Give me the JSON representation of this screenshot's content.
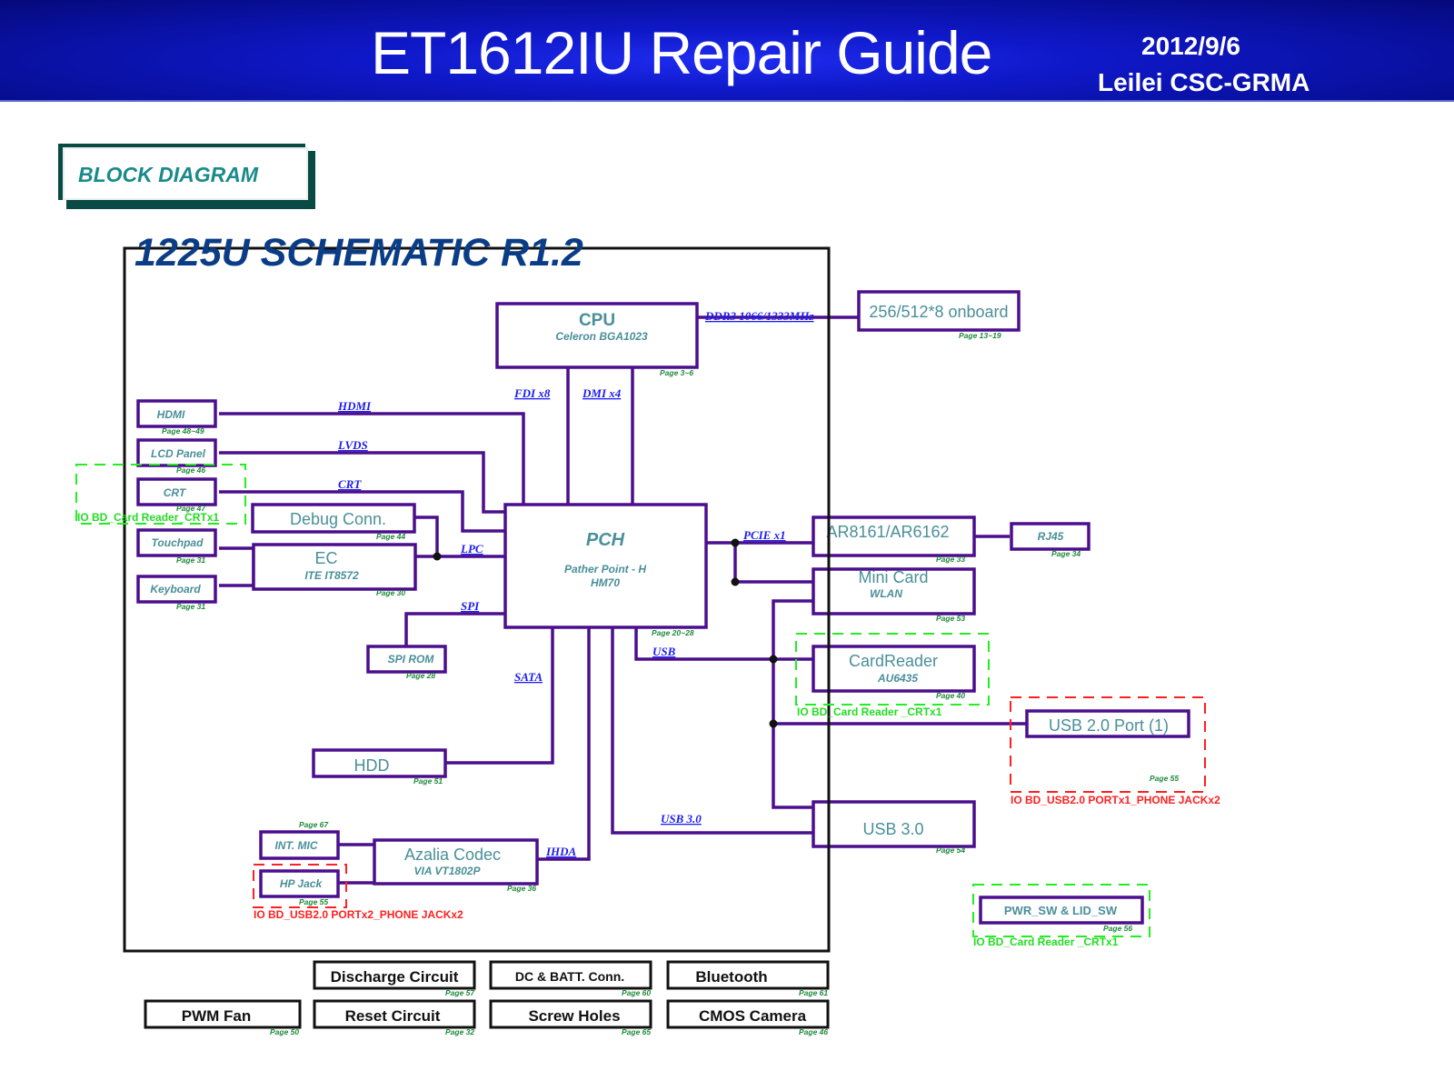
{
  "header": {
    "title": "ET1612IU Repair Guide",
    "date": "2012/9/6",
    "author": "Leilei CSC-GRMA"
  },
  "section_label": "BLOCK DIAGRAM",
  "schematic_title": "1225U SCHEMATIC R1.2",
  "blocks": {
    "cpu": {
      "title": "CPU",
      "sub": "Celeron BGA1023",
      "page": "Page 3~6"
    },
    "memory": {
      "title": "256/512*8 onboard",
      "page": "Page 13~19"
    },
    "pch": {
      "title": "PCH",
      "sub1": "Pather Point - H",
      "sub2": "HM70",
      "page": "Page 20~28"
    },
    "hdmi": {
      "title": "HDMI",
      "page": "Page 48~49"
    },
    "lcd": {
      "title": "LCD Panel",
      "page": "Page 46"
    },
    "crt": {
      "title": "CRT",
      "page": "Page 47"
    },
    "debug": {
      "title": "Debug Conn.",
      "page": "Page 44"
    },
    "touchpad": {
      "title": "Touchpad",
      "page": "Page 31"
    },
    "ec": {
      "title": "EC",
      "sub": "ITE IT8572",
      "page": "Page 30"
    },
    "keyboard": {
      "title": "Keyboard",
      "page": "Page 31"
    },
    "spirom": {
      "title": "SPI ROM",
      "page": "Page 28"
    },
    "hdd": {
      "title": "HDD",
      "page": "Page 51"
    },
    "intmic": {
      "title": "INT. MIC",
      "page": "Page 67"
    },
    "hpjack": {
      "title": "HP Jack",
      "page": "Page 55"
    },
    "codec": {
      "title": "Azalia Codec",
      "sub": "VIA VT1802P",
      "page": "Page 36"
    },
    "lan": {
      "title": "AR8161/AR6162",
      "page": "Page 33"
    },
    "rj45": {
      "title": "RJ45",
      "page": "Page 34"
    },
    "minicard": {
      "title": "Mini Card",
      "sub": "WLAN",
      "page": "Page 53"
    },
    "cardreader": {
      "title": "CardReader",
      "sub": "AU6435",
      "page": "Page 40"
    },
    "usb2": {
      "title": "USB 2.0 Port (1)",
      "page": "Page 55"
    },
    "usb3": {
      "title": "USB 3.0",
      "page": "Page 54"
    },
    "pwrsw": {
      "title": "PWR_SW & LID_SW",
      "page": "Page 56"
    }
  },
  "buses": {
    "ddr3": "DDR3 1066/1333MHz",
    "fdi": "FDI x8",
    "dmi": "DMI x4",
    "hdmi": "HDMI",
    "lvds": "LVDS",
    "crt": "CRT",
    "lpc": "LPC",
    "spi": "SPI",
    "sata": "SATA",
    "usb": "USB",
    "usb30": "USB 3.0",
    "ihda": "IHDA",
    "pcie": "PCIE x1"
  },
  "io_boards": {
    "left_crt": "IO BD_Card Reader_CRTx1",
    "cardreader": "IO BD_Card Reader _CRTx1",
    "usb2": "IO BD_USB2.0 PORTx1_PHONE JACKx2",
    "hpjack": "IO BD_USB2.0 PORTx2_PHONE JACKx2",
    "pwrsw": "IO BD_Card Reader _CRTx1"
  },
  "extra_modules": [
    {
      "title": "Discharge Circuit",
      "page": "Page 57"
    },
    {
      "title": "DC & BATT. Conn.",
      "page": "Page 60"
    },
    {
      "title": "Bluetooth",
      "page": "Page 61"
    },
    {
      "title": "PWM Fan",
      "page": "Page 50"
    },
    {
      "title": "Reset Circuit",
      "page": "Page 32"
    },
    {
      "title": "Screw Holes",
      "page": "Page 65"
    },
    {
      "title": "CMOS Camera",
      "page": "Page 46"
    }
  ]
}
